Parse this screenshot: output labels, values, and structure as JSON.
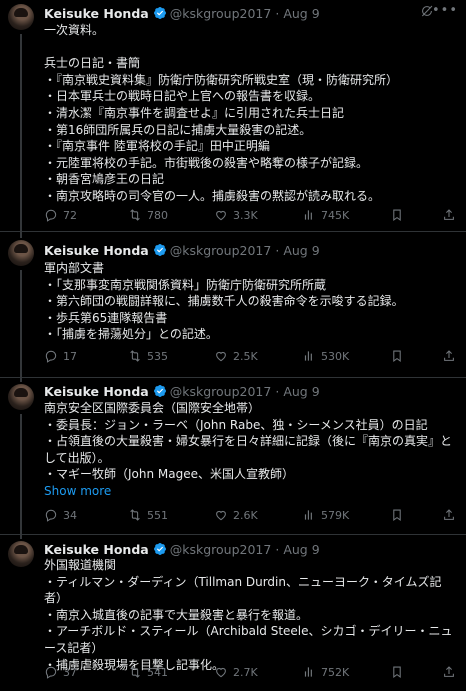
{
  "tweets": [
    {
      "name": "Keisuke Honda",
      "handle": "@kskgroup2017",
      "dot": "·",
      "time": "Aug 9",
      "text": "一次資料。\n\n兵士の日記・書簡\n・『南京戦史資料集』防衛庁防衛研究所戦史室（現・防衛研究所）\n・日本軍兵士の戦時日記や上官への報告書を収録。\n・清水潔『南京事件を調査せよ』に引用された兵士日記\n・第16師団所属兵の日記に捕虜大量殺害の記述。\n・『南京事件 陸軍将校の手記』田中正明編\n・元陸軍将校の手記。市街戦後の殺害や略奪の様子が記録。\n・朝香宮鳩彦王の日記\n・南京攻略時の司令官の一人。捕虜殺害の黙認が読み取れる。",
      "show_more": "",
      "replies": "72",
      "reposts": "780",
      "likes": "3.3K",
      "views": "745K"
    },
    {
      "name": "Keisuke Honda",
      "handle": "@kskgroup2017",
      "dot": "·",
      "time": "Aug 9",
      "text": "軍内部文書\n・「支那事変南京戦関係資料」防衛庁防衛研究所所蔵\n・第六師団の戦闘詳報に、捕虜数千人の殺害命令を示唆する記録。\n・歩兵第65連隊報告書\n・「捕虜を掃蕩処分」との記述。",
      "show_more": "",
      "replies": "17",
      "reposts": "535",
      "likes": "2.5K",
      "views": "530K"
    },
    {
      "name": "Keisuke Honda",
      "handle": "@kskgroup2017",
      "dot": "·",
      "time": "Aug 9",
      "text": "南京安全区国際委員会（国際安全地帯）\n・委員長：ジョン・ラーベ（John Rabe、独・シーメンス社員）の日記\n・占領直後の大量殺害・婦女暴行を日々詳細に記録（後に『南京の真実』として出版）。\n・マギー牧師（John Magee、米国人宣教師）",
      "show_more": "Show more",
      "replies": "34",
      "reposts": "551",
      "likes": "2.6K",
      "views": "579K"
    },
    {
      "name": "Keisuke Honda",
      "handle": "@kskgroup2017",
      "dot": "·",
      "time": "Aug 9",
      "text": "外国報道機関\n・ティルマン・ダーディン（Tillman Durdin、ニューヨーク・タイムズ記者）\n・南京入城直後の記事で大量殺害と暴行を報道。\n・アーチボルド・スティール（Archibald Steele、シカゴ・デイリー・ニュース記者）\n・捕虜虐殺現場を目撃し記事化。",
      "show_more": "",
      "replies": "37",
      "reposts": "541",
      "likes": "2.7K",
      "views": "752K"
    }
  ],
  "colors": {
    "bg": "#000000",
    "text": "#e7e9ea",
    "muted": "#71767b",
    "link": "#1d9bf0",
    "verified": "#1d9bf0"
  },
  "icons": [
    "verified-badge-icon",
    "grok-icon",
    "more-icon",
    "reply-icon",
    "repost-icon",
    "like-icon",
    "views-icon",
    "bookmark-icon",
    "share-icon"
  ]
}
